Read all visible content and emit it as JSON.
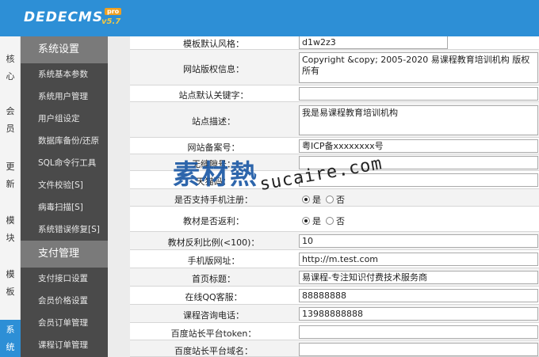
{
  "header": {
    "logo_text_1": "DEDE",
    "logo_text_2": "CMS",
    "logo_badge": "pro",
    "logo_version": "v5.7",
    "bg_color": "#2d8fd6"
  },
  "left_tabs": [
    {
      "label": "核\n心"
    },
    {
      "label": "会\n员"
    },
    {
      "label": "更\n新"
    },
    {
      "label": "模\n块"
    },
    {
      "label": "模\n板"
    },
    {
      "label": "系\n统"
    }
  ],
  "menu": {
    "group1": "系统设置",
    "items1": [
      "系统基本参数",
      "系统用户管理",
      "用户组设定",
      "数据库备份/还原",
      "SQL命令行工具",
      "文件校验[S]",
      "病毒扫描[S]",
      "系统错误修复[S]"
    ],
    "group2": "支付管理",
    "items2": [
      "支付接口设置",
      "会员价格设置",
      "会员订单管理",
      "课程订单管理"
    ]
  },
  "form": {
    "rows": [
      {
        "label": "模板默认风格：",
        "value": "d1w2z3"
      },
      {
        "label": "网站版权信息：",
        "value": "Copyright &copy; 2005-2020 易课程教育培训机构 版权所有"
      },
      {
        "label": "站点默认关键字：",
        "value": ""
      },
      {
        "label": "站点描述：",
        "value": "我是易课程教育培训机构"
      },
      {
        "label": "网站备案号：",
        "value": "粤ICP备xxxxxxxx号"
      },
      {
        "label": "无缝隙号：",
        "value": ""
      },
      {
        "label": "天猫码：",
        "value": ""
      },
      {
        "label": "是否支持手机注册：",
        "opt_yes": "是",
        "opt_no": "否"
      },
      {
        "label": "教材是否返利：",
        "opt_yes": "是",
        "opt_no": "否"
      },
      {
        "label": "教材反利比例(<100)：",
        "value": "10"
      },
      {
        "label": "手机版网址：",
        "value": "http://m.test.com"
      },
      {
        "label": "首页标题：",
        "value": "易课程-专注知识付费技术服务商"
      },
      {
        "label": "在线QQ客服：",
        "value": "88888888"
      },
      {
        "label": "课程咨询电话：",
        "value": "13988888888"
      },
      {
        "label": "百度站长平台token：",
        "value": ""
      },
      {
        "label": "百度站长平台域名：",
        "value": ""
      }
    ]
  },
  "watermark": {
    "cn": "素材熱",
    "en": "sucaire.com"
  }
}
